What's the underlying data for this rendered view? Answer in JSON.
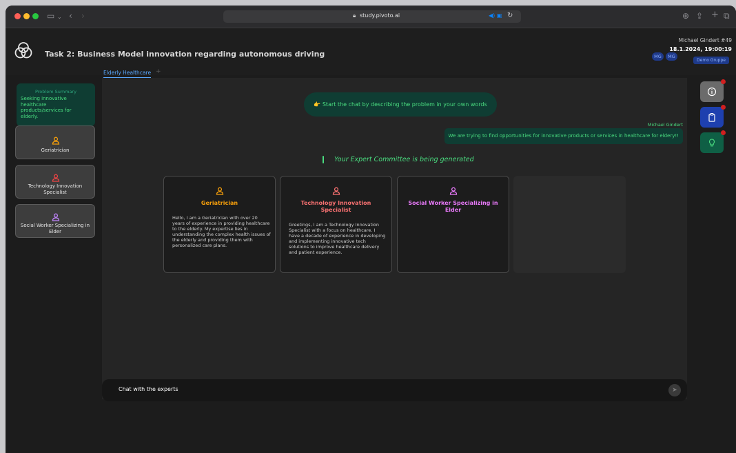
{
  "browser": {
    "url": "study.pivoto.ai"
  },
  "header": {
    "task_title": "Task 2: Business Model innovation regarding autonomous driving",
    "avatars": [
      "MG",
      "MG"
    ],
    "user_name": "Michael Gindert #49",
    "datetime": "18.1.2024, 19:00:19",
    "group": "Demo Gruppe"
  },
  "tabs": {
    "active": "Elderly Healthcare",
    "add": "+"
  },
  "sidebar": {
    "summary_label": "Problem Summary",
    "summary_text": "Seeking innovative healthcare products/services for elderly.",
    "experts": [
      {
        "label": "Geriatrician",
        "color": "#f59e0b"
      },
      {
        "label": "Technology Innovation Specialist",
        "color": "#ef4444"
      },
      {
        "label": "Social Worker Specializing in Elder",
        "color": "#c084fc"
      }
    ]
  },
  "chat": {
    "hint": "👉 Start the chat by describing the problem in your own words",
    "sender": "Michael Gindert",
    "message": "We are trying to find opportunities for innovative products or services in healthcare for eldery!!",
    "generating": "Your Expert Committee is being generated",
    "input_placeholder": "Chat with the experts"
  },
  "cards": [
    {
      "title": "Geriatrician",
      "color": "#f59e0b",
      "desc": "Hello, I am a Geriatrician with over 20 years of experience in providing healthcare to the elderly. My expertise lies in understanding the complex health issues of the elderly and providing them with personalized care plans."
    },
    {
      "title": "Technology Innovation Specialist",
      "color": "#f87171",
      "desc": "Greetings, I am a Technology Innovation Specialist with a focus on healthcare. I have a decade of experience in developing and implementing innovative tech solutions to improve healthcare delivery and patient experience."
    },
    {
      "title": "Social Worker Specializing in Elder",
      "color": "#e879f9",
      "desc": ""
    }
  ],
  "tools": [
    {
      "icon": "info-icon",
      "color": "#6b6b6b"
    },
    {
      "icon": "clipboard-icon",
      "color": "#1e40af"
    },
    {
      "icon": "lightbulb-icon",
      "color": "#0f5f45"
    }
  ]
}
